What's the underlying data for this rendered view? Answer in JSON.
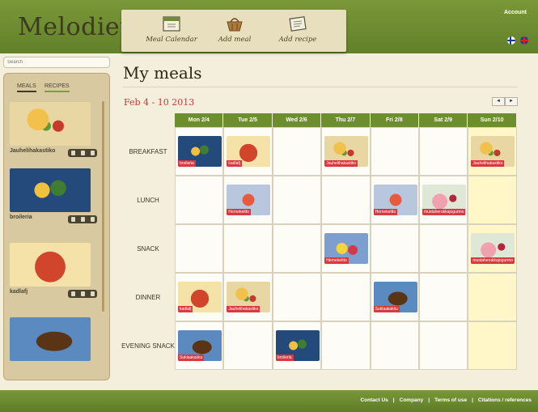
{
  "header": {
    "logo": "Melodiet",
    "nav": [
      {
        "label": "Meal Calendar",
        "icon": "calendar-icon"
      },
      {
        "label": "Add meal",
        "icon": "basket-icon"
      },
      {
        "label": "Add recipe",
        "icon": "recipe-icon"
      }
    ],
    "account": "Account"
  },
  "sidebar": {
    "search_placeholder": "Search",
    "tabs": [
      "MEALS",
      "RECIPES"
    ],
    "items": [
      {
        "name": "Jauhelihakastiko",
        "food": "food-pasta"
      },
      {
        "name": "broileria",
        "food": "food-veg"
      },
      {
        "name": "kadlafj",
        "food": "food-tart"
      },
      {
        "name": "",
        "food": "food-choc"
      }
    ]
  },
  "main": {
    "title": "My meals",
    "date_range": "Feb 4 - 10 2013",
    "prev": "◄",
    "next": "►"
  },
  "calendar": {
    "days": [
      "Mon 2/4",
      "Tue 2/5",
      "Wed 2/6",
      "Thu 2/7",
      "Fri 2/8",
      "Sat 2/9",
      "Sun 2/10"
    ],
    "rows": [
      "BREAKFAST",
      "LUNCH",
      "SNACK",
      "DINNER",
      "EVENING SNACK"
    ],
    "cells": {
      "0-0": {
        "label": "broileria",
        "food": "food-veg"
      },
      "0-1": {
        "label": "kadlafj",
        "food": "food-tart"
      },
      "0-3": {
        "label": "Jauhelihakastiko",
        "food": "food-pasta"
      },
      "0-6": {
        "label": "Jauhelihakastiko",
        "food": "food-pasta"
      },
      "1-1": {
        "label": "Hernekeitto",
        "food": "food-tomato"
      },
      "1-4": {
        "label": "Hernekeitto",
        "food": "food-tomato"
      },
      "1-5": {
        "label": "mustaherukkajogurmo",
        "food": "food-berry"
      },
      "2-3": {
        "label": "Hernekeitto",
        "food": "food-lemon"
      },
      "2-6": {
        "label": "mustaherukkajogurmo",
        "food": "food-berry"
      },
      "3-0": {
        "label": "kadlafj",
        "food": "food-tart"
      },
      "3-1": {
        "label": "Jauhelihakastiko",
        "food": "food-pasta"
      },
      "3-4": {
        "label": "Suklaakakku",
        "food": "food-choc"
      },
      "4-0": {
        "label": "Suklaakakku",
        "food": "food-choc"
      },
      "4-2": {
        "label": "broileria",
        "food": "food-veg"
      }
    }
  },
  "footer": {
    "links": [
      "Contact Us",
      "Company",
      "Terms of use",
      "Citations / references"
    ]
  }
}
